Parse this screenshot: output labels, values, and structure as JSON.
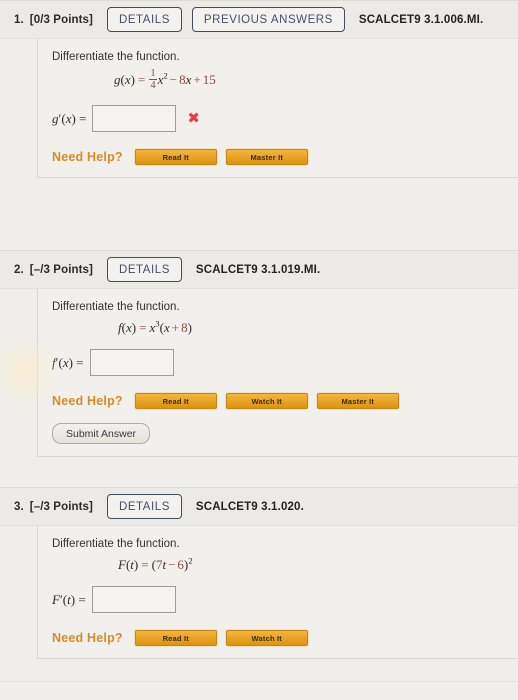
{
  "page": {
    "background_color": "#efeeea",
    "panel_color": "#f1f0ec",
    "header_color": "#eceae6",
    "accent_help_color": "#d98b26",
    "accent_button_color": "#e8a221",
    "pill_border_color": "#414b63",
    "pill_text_color": "#42506c",
    "math_number_color": "#8f4a3c",
    "incorrect_mark_color": "#e2413c"
  },
  "questions": [
    {
      "number": "1.",
      "points": "[0/3 Points]",
      "details_label": "DETAILS",
      "previous_answers_label": "PREVIOUS ANSWERS",
      "code": "SCALCET9 3.1.006.MI.",
      "prompt": "Differentiate the function.",
      "equation": {
        "lhs_fn": "g",
        "lhs_var": "x",
        "fraction_numerator": "1",
        "fraction_denominator": "4",
        "term_var": "x",
        "term_exponent": "2",
        "op1": "−",
        "coefficient2": "8",
        "var2": "x",
        "op2": "+",
        "constant": "15"
      },
      "answer_label_fn": "g",
      "answer_label_var": "x",
      "answer_value": "",
      "answer_placeholder": "",
      "mark": "✖",
      "has_mark": true,
      "help_label": "Need Help?",
      "help_buttons": [
        "Read It",
        "Master It"
      ],
      "has_submit": false,
      "submit_label": ""
    },
    {
      "number": "2.",
      "points": "[–/3 Points]",
      "details_label": "DETAILS",
      "previous_answers_label": "",
      "code": "SCALCET9 3.1.019.MI.",
      "prompt": "Differentiate the function.",
      "equation": {
        "lhs_fn": "f",
        "lhs_var": "x",
        "base_var": "x",
        "base_exponent": "3",
        "inner_var": "x",
        "inner_op": "+",
        "inner_const": "8"
      },
      "answer_label_fn": "f",
      "answer_label_var": "x",
      "answer_value": "",
      "answer_placeholder": "",
      "mark": "",
      "has_mark": false,
      "help_label": "Need Help?",
      "help_buttons": [
        "Read It",
        "Watch It",
        "Master It"
      ],
      "has_submit": true,
      "submit_label": "Submit Answer"
    },
    {
      "number": "3.",
      "points": "[–/3 Points]",
      "details_label": "DETAILS",
      "previous_answers_label": "",
      "code": "SCALCET9 3.1.020.",
      "prompt": "Differentiate the function.",
      "equation": {
        "lhs_fn": "F",
        "lhs_var": "t",
        "coefficient": "7",
        "inner_var": "t",
        "inner_op": "−",
        "inner_const": "6",
        "exponent": "2"
      },
      "answer_label_fn": "F",
      "answer_label_var": "t",
      "answer_value": "",
      "answer_placeholder": "",
      "mark": "",
      "has_mark": false,
      "help_label": "Need Help?",
      "help_buttons": [
        "Read It",
        "Watch It"
      ],
      "has_submit": false,
      "submit_label": ""
    }
  ]
}
